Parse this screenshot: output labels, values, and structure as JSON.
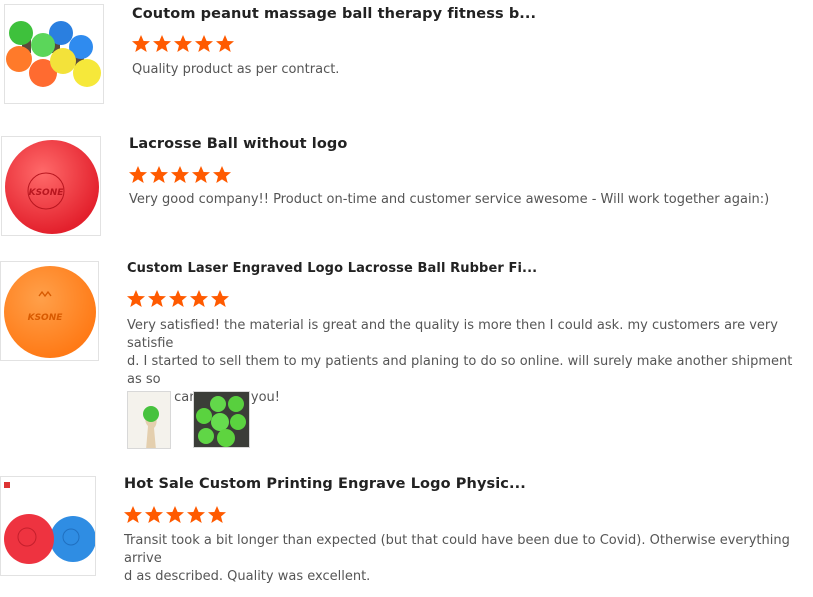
{
  "reviews": [
    {
      "title": "Coutom peanut massage ball therapy fitness b...",
      "rating": 5,
      "text": "Quality product as per contract.",
      "image_icon": "peanut-massage-balls-image"
    },
    {
      "title": "Lacrosse Ball without logo",
      "rating": 5,
      "text": "Very good company!! Product on-time and customer service awesome - Will work together again:)",
      "image_icon": "red-lacrosse-ball-image",
      "logo_text": "KSONE"
    },
    {
      "title": "Custom Laser Engraved Logo Lacrosse Ball Rubber Fi...",
      "rating": 5,
      "text_lines": [
        "Very satisfied! the material is great and the quality is more then I could ask. my customers are very satisfie",
        "d. I started to sell them to my patients and planing to do so online. will surely make another shipment as so",
        "on as I can! Thank you!"
      ],
      "image_icon": "orange-lacrosse-ball-image",
      "logo_text": "KSONE",
      "photos": [
        "customer-photo-hand-holding-ball",
        "customer-photo-green-balls"
      ]
    },
    {
      "title": "Hot Sale Custom Printing Engrave Logo Physic...",
      "rating": 5,
      "text_lines": [
        "Transit took a bit longer than expected (but that could have been due to Covid). Otherwise everything arrive",
        "d as described. Quality was excellent."
      ],
      "image_icon": "red-and-blue-balls-image"
    }
  ],
  "colors": {
    "star": "#ff5a00",
    "title": "#222222",
    "body_text": "#555555"
  }
}
